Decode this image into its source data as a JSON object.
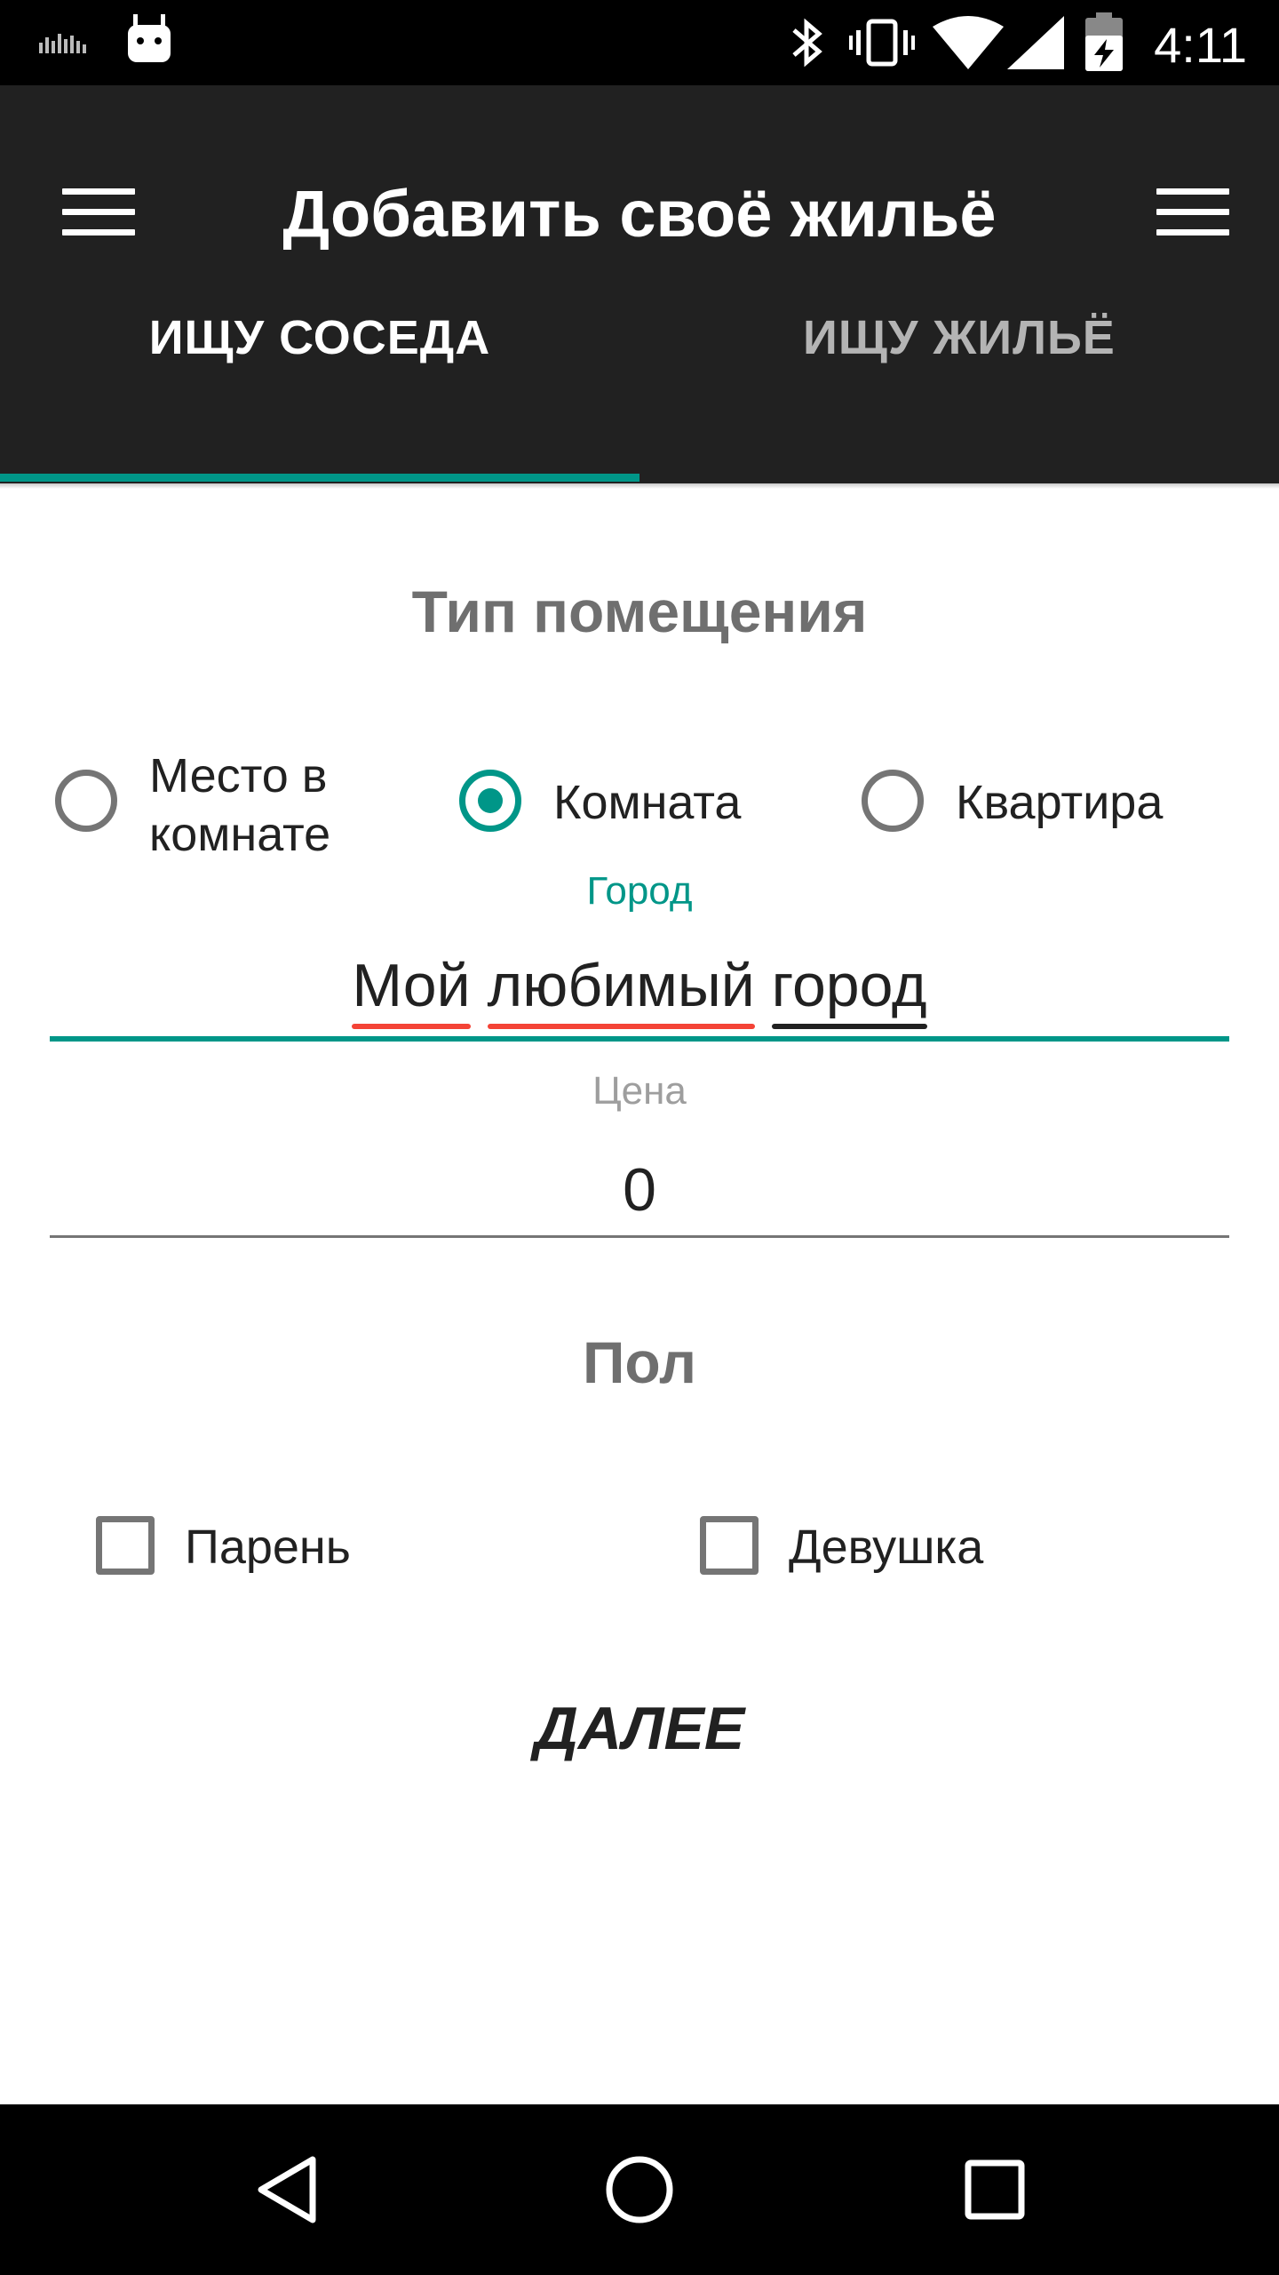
{
  "status_bar": {
    "time": "4:11"
  },
  "app_bar": {
    "title": "Добавить своё жильё",
    "left_menu_icon": "hamburger-icon",
    "right_menu_icon": "hamburger-icon"
  },
  "tabs": [
    {
      "label": "ИЩУ СОСЕДА",
      "selected": true
    },
    {
      "label": "ИЩУ ЖИЛЬЁ",
      "selected": false
    }
  ],
  "room_type": {
    "title": "Тип помещения",
    "options": [
      {
        "label_line1": "Место в",
        "label_line2": "комнате",
        "checked": false
      },
      {
        "label": "Комната",
        "checked": true
      },
      {
        "label": "Квартира",
        "checked": false
      }
    ]
  },
  "city": {
    "label": "Город",
    "value_words": [
      "Мой",
      "любимый",
      "город"
    ]
  },
  "price": {
    "label": "Цена",
    "value": "0"
  },
  "gender": {
    "title": "Пол",
    "options": [
      {
        "label": "Парень",
        "checked": false
      },
      {
        "label": "Девушка",
        "checked": false
      }
    ]
  },
  "next_button": {
    "label": "ДАЛЕЕ"
  },
  "colors": {
    "accent": "#009688",
    "app_bar": "#212121",
    "spellcheck": "#f44336"
  }
}
